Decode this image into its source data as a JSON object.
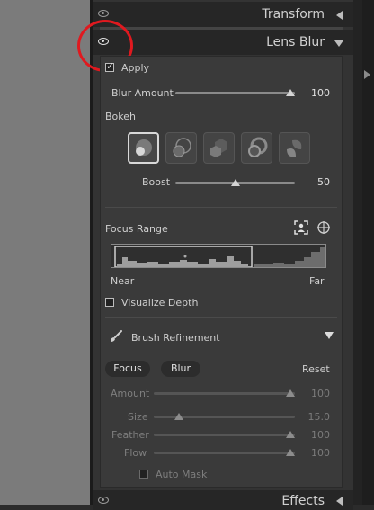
{
  "panels": {
    "transform": {
      "title": "Transform"
    },
    "lens_blur": {
      "title": "Lens Blur"
    },
    "effects": {
      "title": "Effects"
    }
  },
  "lens_blur": {
    "apply_label": "Apply",
    "apply_checked": true,
    "blur_amount": {
      "label": "Blur Amount",
      "value": "100",
      "level": 1.0
    },
    "bokeh": {
      "label": "Bokeh",
      "shapes": [
        "circle",
        "bubble",
        "blade",
        "ring",
        "cat-eye"
      ],
      "selected_index": 0
    },
    "boost": {
      "label": "Boost",
      "value": "50",
      "level": 0.5
    },
    "focus_range": {
      "label": "Focus Range",
      "near_label": "Near",
      "far_label": "Far"
    },
    "visualize_depth": {
      "label": "Visualize Depth",
      "checked": false
    },
    "brush_refinement": {
      "label": "Brush Refinement",
      "focus_button": "Focus",
      "blur_button": "Blur",
      "reset_button": "Reset",
      "amount": {
        "label": "Amount",
        "value": "100",
        "level": 1.0
      },
      "size": {
        "label": "Size",
        "value": "15.0",
        "level": 0.18
      },
      "feather": {
        "label": "Feather",
        "value": "100",
        "level": 1.0
      },
      "flow": {
        "label": "Flow",
        "value": "100",
        "level": 1.0
      },
      "auto_mask": {
        "label": "Auto Mask",
        "checked": false
      }
    }
  },
  "colors": {
    "highlight_circle": "#e0191f",
    "panel_bg": "#333333",
    "header_bg": "#262626"
  }
}
